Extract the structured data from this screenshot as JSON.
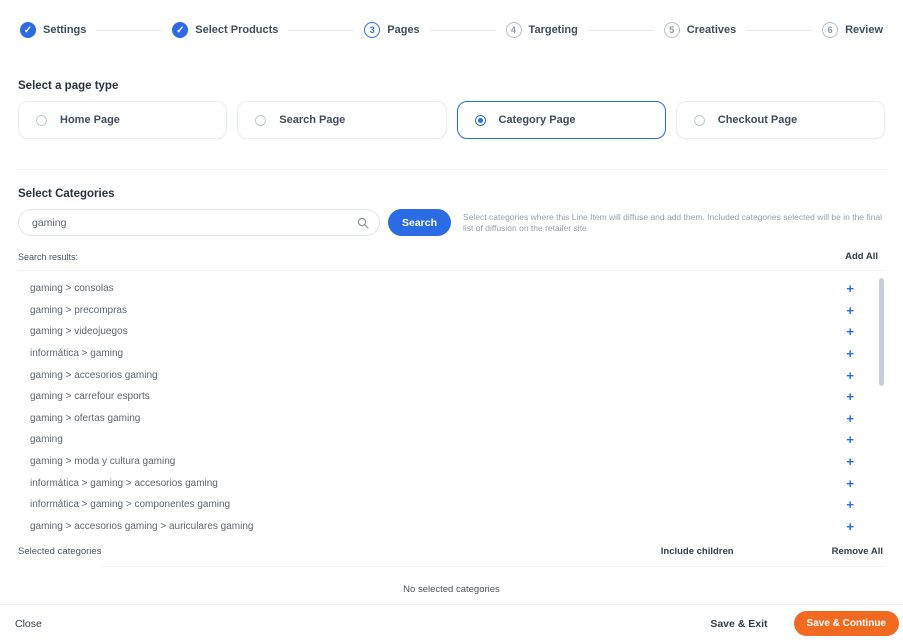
{
  "stepper": {
    "steps": [
      {
        "label": "Settings",
        "state": "completed"
      },
      {
        "label": "Select Products",
        "state": "completed"
      },
      {
        "label": "Pages",
        "number": "3",
        "state": "current"
      },
      {
        "label": "Targeting",
        "number": "4",
        "state": "upcoming"
      },
      {
        "label": "Creatives",
        "number": "5",
        "state": "upcoming"
      },
      {
        "label": "Review",
        "number": "6",
        "state": "upcoming"
      }
    ]
  },
  "page_type": {
    "label": "Select a page type",
    "options": [
      {
        "label": "Home Page",
        "selected": false
      },
      {
        "label": "Search Page",
        "selected": false
      },
      {
        "label": "Category Page",
        "selected": true
      },
      {
        "label": "Checkout Page",
        "selected": false
      }
    ]
  },
  "categories": {
    "label": "Select Categories",
    "search_value": "gaming",
    "search_button": "Search",
    "helper_text": "Select categories where this Line Item will diffuse and add them. Included categories selected will be in the final list of diffusion on the retailer site",
    "results_label": "Search results:",
    "add_all_label": "Add All",
    "results": [
      "gaming > consolas",
      "gaming > precompras",
      "gaming > videojuegos",
      "informática > gaming",
      "gaming > accesorios gaming",
      "gaming > carrefour esports",
      "gaming > ofertas gaming",
      "gaming",
      "gaming > moda y cultura gaming",
      "informática > gaming > accesorios gaming",
      "informática > gaming > componentes gaming",
      "gaming > accesorios gaming > auriculares gaming"
    ]
  },
  "selected_section": {
    "label": "Selected categories",
    "include_children_label": "Include children",
    "remove_all_label": "Remove All",
    "empty_text": "No selected categories"
  },
  "footer": {
    "close_label": "Close",
    "save_exit_label": "Save & Exit",
    "save_continue_label": "Save & Continue"
  },
  "icons": {
    "check": "✓",
    "plus": "+"
  },
  "colors": {
    "accent_blue": "#2B6BE4",
    "accent_orange": "#F26A21"
  }
}
